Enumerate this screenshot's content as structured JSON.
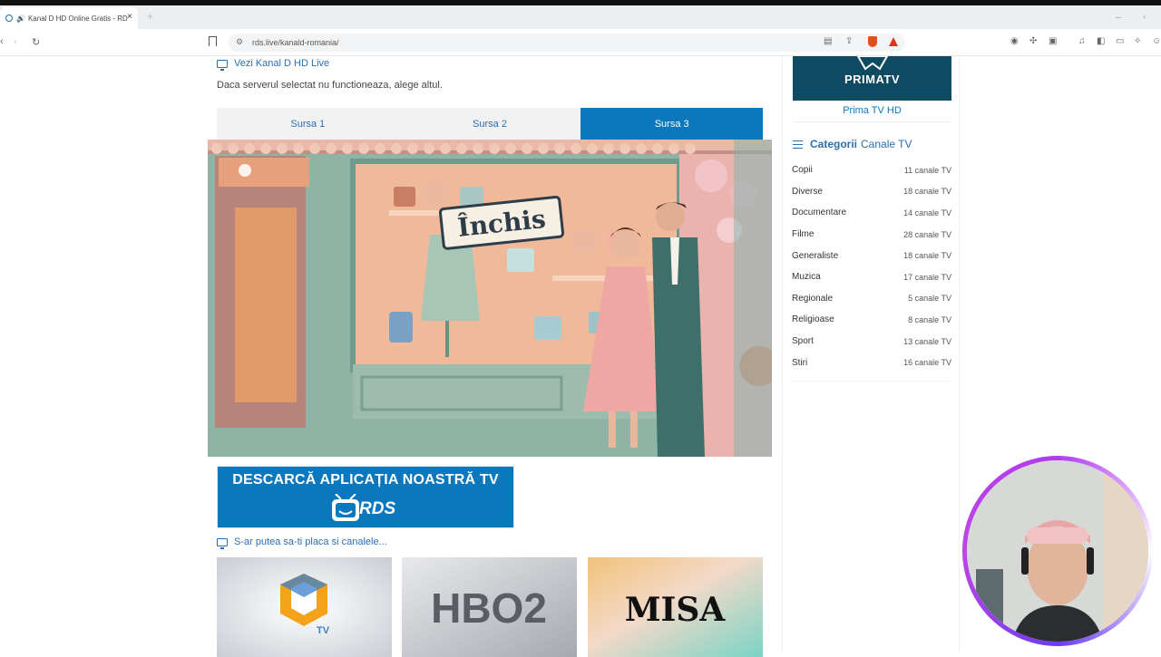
{
  "browser": {
    "tab_title": "Kanal D HD Online Gratis - RD",
    "url": "rds.live/kanald-romania/"
  },
  "page": {
    "live_title": "Vezi Kanal D HD Live",
    "hint": "Daca serverul selectat nu functioneaza, alege altul.",
    "sources": [
      "Sursa 1",
      "Sursa 2",
      "Sursa 3"
    ],
    "active_source": "Sursa 3",
    "player_sign": "Închis",
    "app_banner": {
      "headline": "DESCARCĂ APLICAȚIA NOASTRĂ TV",
      "brand": "RDS"
    },
    "suggest_title": "S-ar putea sa-ti placa si canalele...",
    "thumbs": [
      {
        "label": "TV",
        "brand_color": "#f3a21a"
      },
      {
        "label": "HBO2"
      },
      {
        "label": "MISA"
      }
    ]
  },
  "sidebar": {
    "featured": {
      "logo_text": "PRIMATV",
      "caption": "Prima TV HD"
    },
    "categories_title_bold": "Categorii",
    "categories_title_light": "Canale TV",
    "categories": [
      {
        "name": "Copii",
        "count": "11 canale TV"
      },
      {
        "name": "Diverse",
        "count": "18 canale TV"
      },
      {
        "name": "Documentare",
        "count": "14 canale TV"
      },
      {
        "name": "Filme",
        "count": "28 canale TV"
      },
      {
        "name": "Generaliste",
        "count": "18 canale TV"
      },
      {
        "name": "Muzica",
        "count": "17 canale TV"
      },
      {
        "name": "Regionale",
        "count": "5 canale TV"
      },
      {
        "name": "Religioase",
        "count": "8 canale TV"
      },
      {
        "name": "Sport",
        "count": "13 canale TV"
      },
      {
        "name": "Stiri",
        "count": "16 canale TV"
      }
    ]
  },
  "colors": {
    "accent": "#0b77bd",
    "link": "#2a6fb0"
  }
}
